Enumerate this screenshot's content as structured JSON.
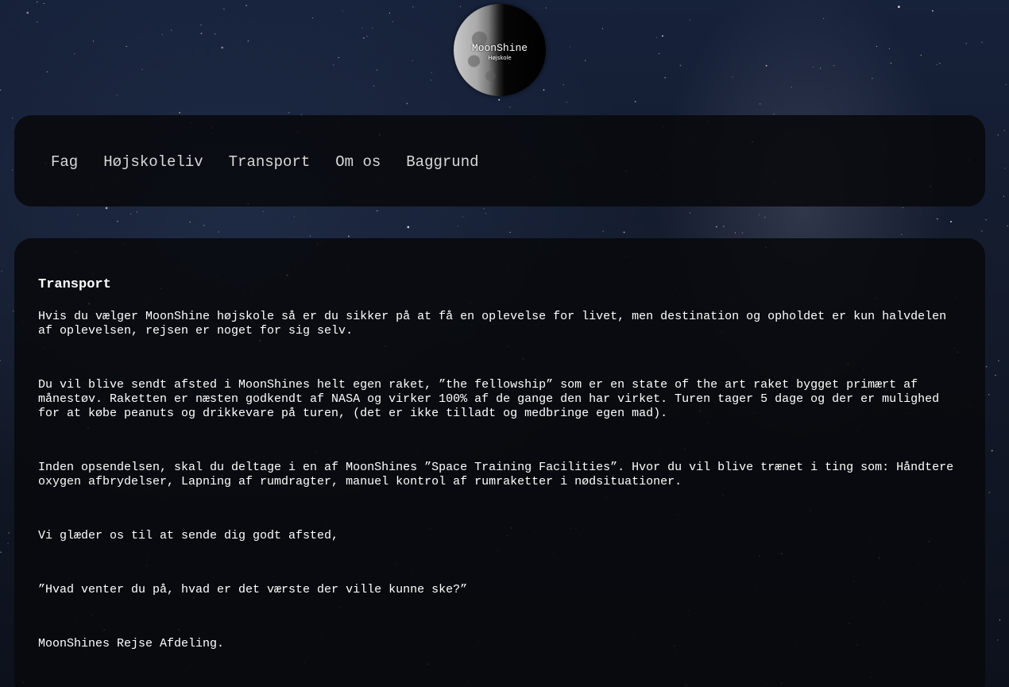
{
  "logo": {
    "title": "MoonShine",
    "subtitle": "Højskole"
  },
  "nav": {
    "items": [
      {
        "label": "Fag"
      },
      {
        "label": "Højskoleliv"
      },
      {
        "label": "Transport"
      },
      {
        "label": "Om os"
      },
      {
        "label": "Baggrund"
      }
    ]
  },
  "content": {
    "title": "Transport",
    "paragraphs": [
      "Hvis du vælger MoonShine højskole så er du sikker på at få en oplevelse for livet, men destination og opholdet er kun halvdelen af oplevelsen, rejsen er noget for sig selv.",
      "Du vil blive sendt afsted i MoonShines helt egen raket, ”the fellowship” som er en state of the art raket bygget primært af månestøv. Raketten er næsten godkendt af NASA og virker 100% af de gange den har virket. Turen tager 5 dage og der er mulighed for at købe peanuts og drikkevare på turen, (det er ikke tilladt og medbringe egen mad).",
      "Inden opsendelsen, skal du deltage i en af MoonShines ”Space Training Facilities”. Hvor du vil blive trænet i ting som: Håndtere oxygen afbrydelser, Lapning af rumdragter, manuel kontrol af rumraketter i nødsituationer.",
      "Vi glæder os til at sende dig godt afsted,",
      "”Hvad venter du på, hvad er det værste der ville kunne ske?”",
      "MoonShines Rejse Afdeling."
    ]
  }
}
